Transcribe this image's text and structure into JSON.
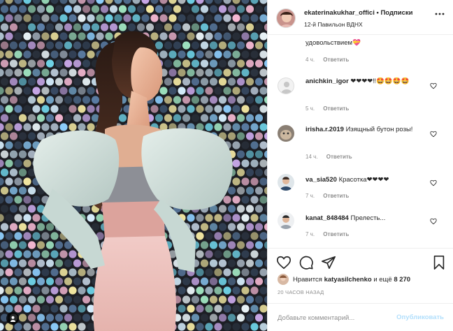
{
  "post": {
    "username": "ekaterinakukhar_offici",
    "separator": "•",
    "follow_label": "Подписки",
    "location": "12-й Павильон ВДНХ"
  },
  "comments": [
    {
      "user": "",
      "text": "удовольствием💝",
      "time": "4 ч.",
      "reply": "Ответить"
    },
    {
      "user": "anichkin_igor",
      "text": "❤❤❤❤‼🤩🤩🤩🤩",
      "time": "5 ч.",
      "reply": "Ответить"
    },
    {
      "user": "irisha.r.2019",
      "text": "Изящный бутон розы!",
      "time": "14 ч.",
      "reply": "Ответить"
    },
    {
      "user": "va_sia520",
      "text": "Красотка❤❤❤❤",
      "time": "7 ч.",
      "reply": "Ответить"
    },
    {
      "user": "kanat_848484",
      "text": "Прелесть...",
      "time": "7 ч.",
      "reply": "Ответить"
    }
  ],
  "likes": {
    "prefix": "Нравится",
    "user": "katyasilchenko",
    "middle": "и ещё",
    "count": "8 270"
  },
  "time_ago": "20 ЧАСОВ НАЗАД",
  "add_comment": {
    "placeholder": "Добавьте комментарий...",
    "publish_label": "Опубликовать"
  },
  "colors": {
    "heart": "#ed4956",
    "publish_disabled": "#b2dffc",
    "muted": "#8e8e8e"
  },
  "icons": [
    "more-icon",
    "heart-icon",
    "comment-icon",
    "share-icon",
    "bookmark-icon",
    "user-tag-icon"
  ]
}
